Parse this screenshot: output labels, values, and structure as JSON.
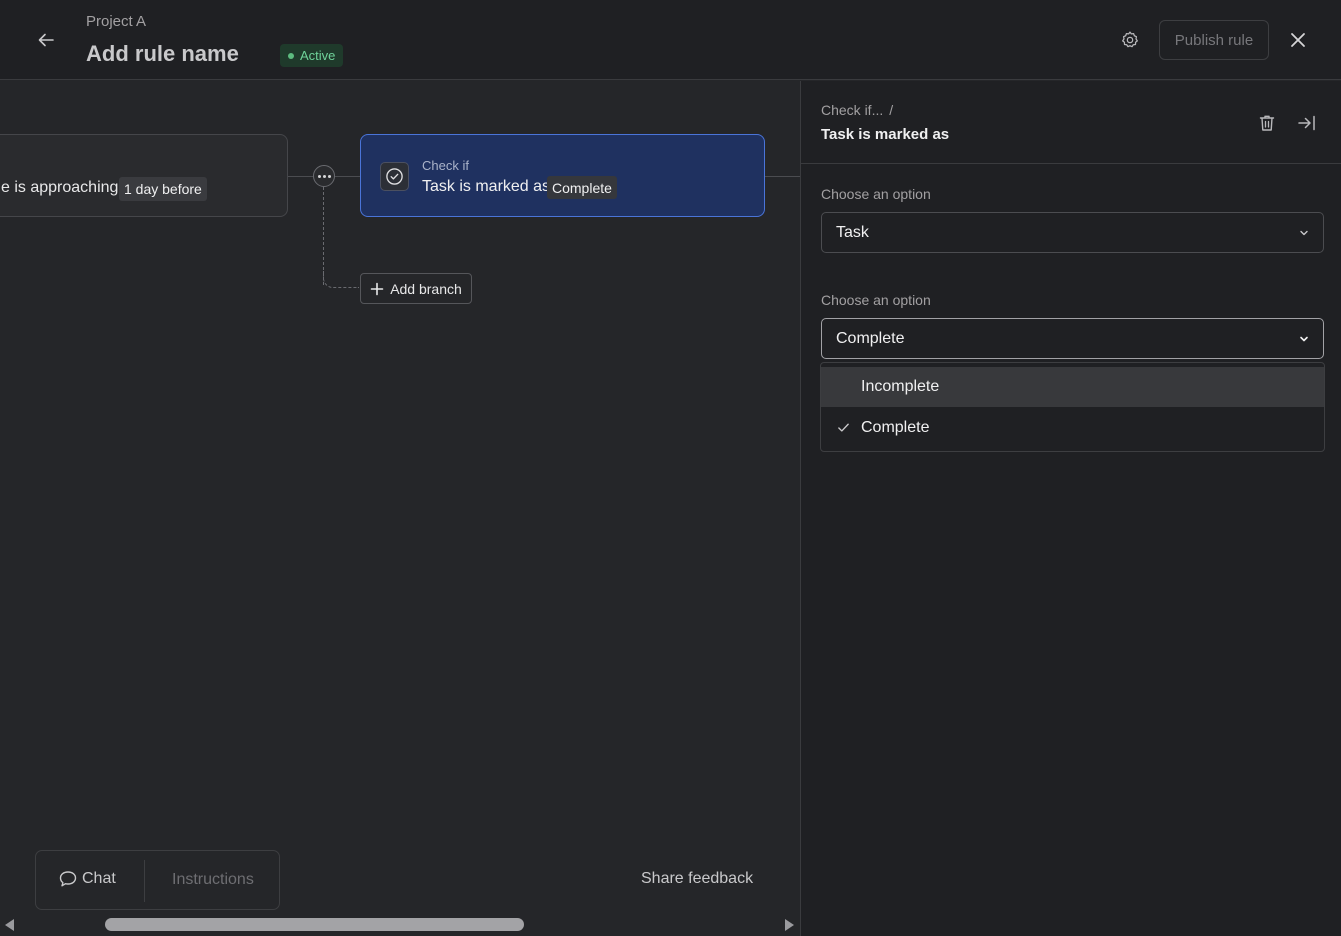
{
  "header": {
    "project": "Project A",
    "rule_name": "Add rule name",
    "status": "Active",
    "publish_label": "Publish rule"
  },
  "canvas": {
    "trigger_text": "e is approaching",
    "trigger_chip": "1 day before",
    "check_title": "Check if",
    "check_text": "Task is marked as",
    "check_chip": "Complete",
    "add_branch_label": "Add branch",
    "chat_label": "Chat",
    "instructions_label": "Instructions",
    "share_feedback_label": "Share feedback"
  },
  "side_panel": {
    "breadcrumb": "Check if...",
    "breadcrumb_sep": "/",
    "title": "Task is marked as",
    "field1_label": "Choose an option",
    "field1_value": "Task",
    "field2_label": "Choose an option",
    "field2_value": "Complete",
    "options": [
      {
        "label": "Incomplete",
        "selected": false
      },
      {
        "label": "Complete",
        "selected": true
      }
    ]
  },
  "colors": {
    "accent_blue": "#4a74d8",
    "card_blue": "#1f3160",
    "status_green": "#6fd39a"
  }
}
